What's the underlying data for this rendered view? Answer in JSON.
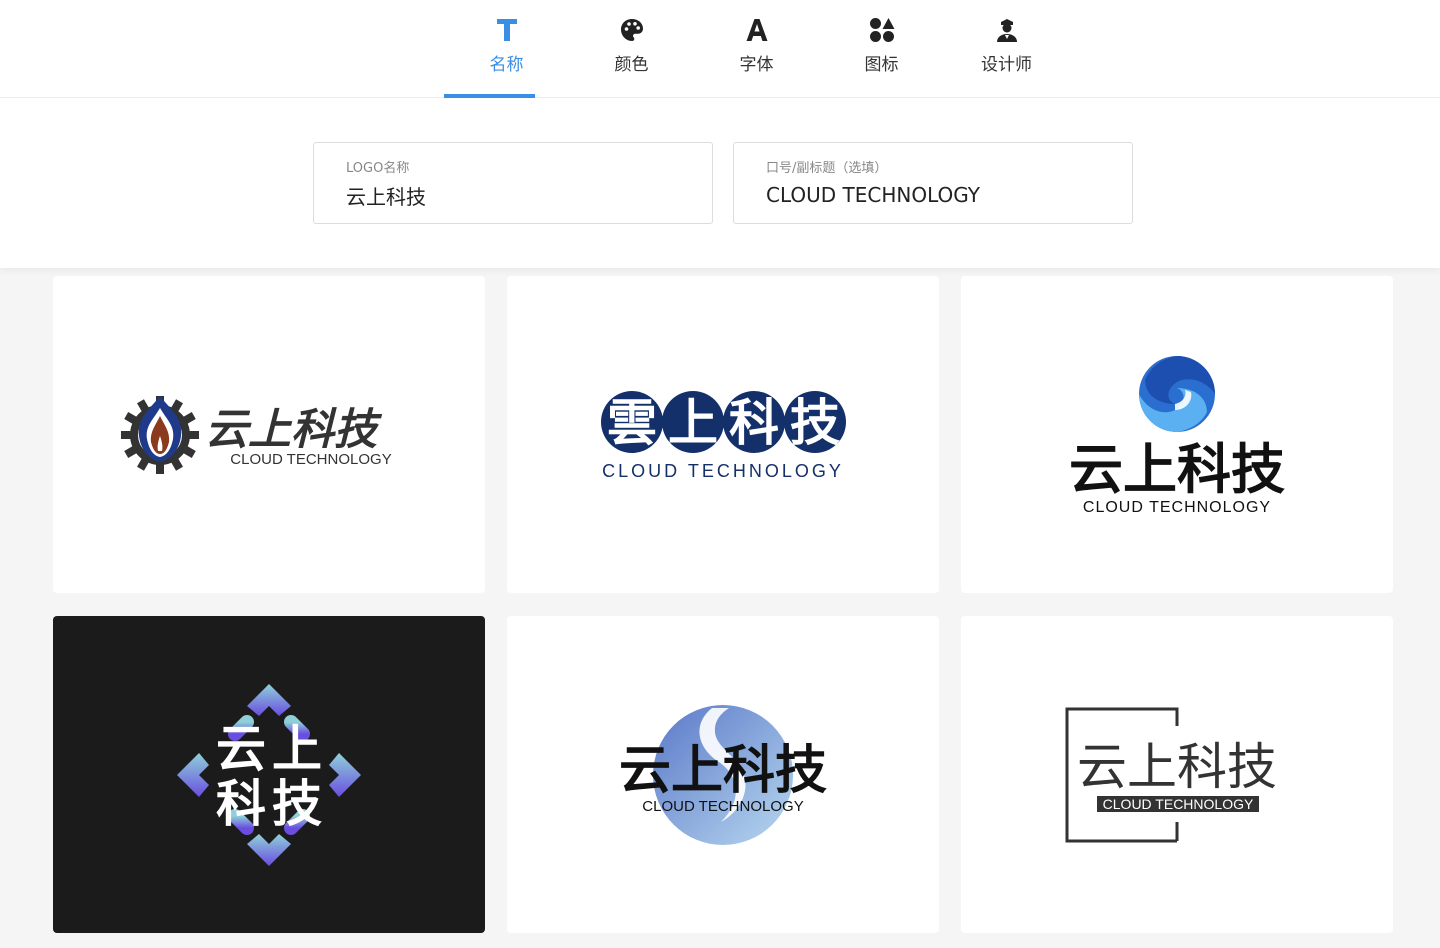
{
  "tabs": [
    {
      "label": "名称",
      "icon": "text-icon",
      "active": true
    },
    {
      "label": "颜色",
      "icon": "palette-icon",
      "active": false
    },
    {
      "label": "字体",
      "icon": "font-icon",
      "active": false
    },
    {
      "label": "图标",
      "icon": "shapes-icon",
      "active": false
    },
    {
      "label": "设计师",
      "icon": "designer-icon",
      "active": false
    }
  ],
  "form": {
    "name_label": "LOGO名称",
    "name_value": "云上科技",
    "slogan_label": "口号/副标题（选填）",
    "slogan_value": "CLOUD TECHNOLOGY"
  },
  "logos": {
    "name": "云上科技",
    "name_traditional": "雲上科技",
    "slogan": "CLOUD TECHNOLOGY",
    "chars": [
      "云",
      "上",
      "科",
      "技"
    ],
    "chars_traditional": [
      "雲",
      "上",
      "科",
      "技"
    ]
  },
  "colors": {
    "accent": "#3a8ee6",
    "navy": "#14306b",
    "dark_card": "#1b1b1b"
  }
}
